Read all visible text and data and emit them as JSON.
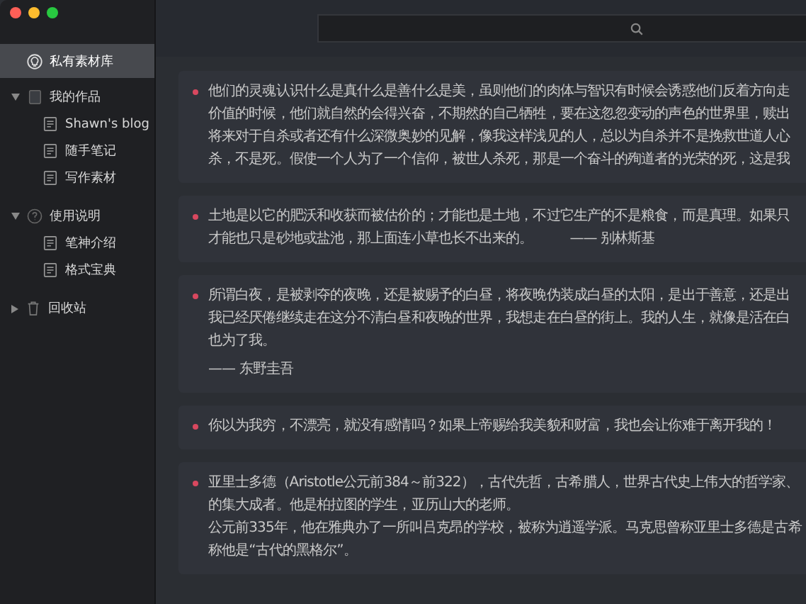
{
  "sidebar": {
    "items": [
      {
        "label": "私有素材库",
        "kind": "library",
        "selected": true
      },
      {
        "label": "我的作品",
        "kind": "notebook",
        "selected": false,
        "expanded": true,
        "children": [
          {
            "label": "Shawn's blog",
            "kind": "note",
            "selected": false
          },
          {
            "label": "随手笔记",
            "kind": "note",
            "selected": false
          },
          {
            "label": "写作素材",
            "kind": "note",
            "selected": false
          }
        ]
      },
      {
        "label": "使用说明",
        "kind": "help",
        "selected": false,
        "expanded": true,
        "children": [
          {
            "label": "笔神介绍",
            "kind": "note",
            "selected": false
          },
          {
            "label": "格式宝典",
            "kind": "note",
            "selected": false
          }
        ]
      },
      {
        "label": "回收站",
        "kind": "trash",
        "selected": false,
        "expanded": false
      }
    ]
  },
  "cards": [
    {
      "lines": [
        "他们的灵魂认识什么是真什么是善什么是美，虽则他们的肉体与智识有时候会诱惑他们反着方向走",
        "价值的时候，他们就自然的会得兴奋，不期然的自己牺牲，要在这忽忽变动的声色的世界里，赎出",
        "将来对于自杀或者还有什么深微奥妙的见解，像我这样浅见的人，总以为自杀并不是挽救世道人心",
        "杀，不是死。假使一个人为了一个信仰，被世人杀死，那是一个奋斗的殉道者的光荣的死，这是我"
      ]
    },
    {
      "lines": [
        "土地是以它的肥沃和收获而被估价的；才能也是土地，不过它生产的不是粮食，而是真理。如果只",
        "才能也只是砂地或盐池，那上面连小草也长不出来的。"
      ],
      "author": "—— 别林斯基",
      "author_inline": true
    },
    {
      "lines": [
        "所谓白夜，是被剥夺的夜晚，还是被赐予的白昼，将夜晚伪装成白昼的太阳，是出于善意，还是出",
        "我已经厌倦继续走在这分不清白昼和夜晚的世界，我想走在白昼的街上。我的人生，就像是活在白",
        "也为了我。"
      ],
      "author": "—— 东野圭吾",
      "author_inline": false
    },
    {
      "lines": [
        "你以为我穷，不漂亮，就没有感情吗？如果上帝赐给我美貌和财富，我也会让你难于离开我的！"
      ]
    },
    {
      "lines": [
        "亚里士多德（Aristotle公元前384～前322），古代先哲，古希腊人，世界古代史上伟大的哲学家、",
        "的集大成者。他是柏拉图的学生，亚历山大的老师。",
        "公元前335年，他在雅典办了一所叫吕克昂的学校，被称为逍遥学派。马克思曾称亚里士多德是古希",
        "称他是“古代的黑格尔”。"
      ]
    }
  ]
}
